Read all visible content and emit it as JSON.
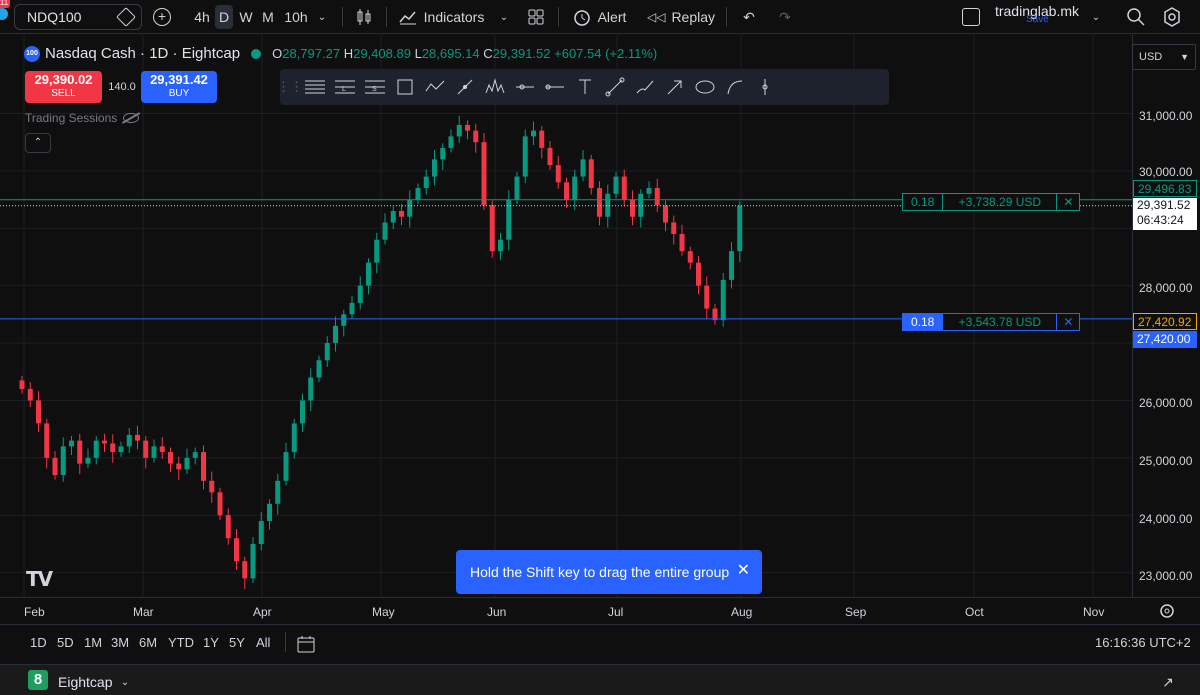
{
  "toolbar": {
    "symbol": "NDQ100",
    "notif_count": "11",
    "timeframes": [
      "4h",
      "D",
      "W",
      "M",
      "10h"
    ],
    "active_timeframe": "D",
    "indicators_label": "Indicators",
    "alert_label": "Alert",
    "replay_label": "Replay",
    "username": "tradinglab.mk",
    "save_label": "Save"
  },
  "legend": {
    "title": "Nasdaq Cash · 1D · Eightcap",
    "logo_text": "100",
    "o_key": "O",
    "o_val": "28,797.27",
    "h_key": "H",
    "h_val": "29,408.89",
    "l_key": "L",
    "l_val": "28,695.14",
    "c_key": "C",
    "c_val": "29,391.52",
    "change": "+607.54 (+2.11%)"
  },
  "trade": {
    "sell_price": "29,390.02",
    "sell_label": "SELL",
    "buy_price": "29,391.42",
    "buy_label": "BUY",
    "spread": "140.0"
  },
  "sessions_label": "Trading Sessions",
  "orders": [
    {
      "qty": "0.18",
      "pnl": "+3,738.29 USD",
      "price": 29496.83
    },
    {
      "qty": "0.18",
      "pnl": "+3,543.78 USD",
      "price": 27420.0
    }
  ],
  "price_axis": {
    "currency": "USD",
    "labels": [
      "31,000.00",
      "30,000.00",
      "28,000.00",
      "26,000.00",
      "25,000.00",
      "24,000.00",
      "23,000.00"
    ],
    "tag_upper": "29,496.83",
    "tag_current": "29,391.52",
    "tag_countdown": "06:43:24",
    "tag_order_price": "27,420.92",
    "tag_order_line": "27,420.00"
  },
  "time_axis": [
    "Feb",
    "Mar",
    "Apr",
    "May",
    "Jun",
    "Jul",
    "Aug",
    "Sep",
    "Oct",
    "Nov"
  ],
  "tooltip": "Hold the Shift key to drag the entire group",
  "ranges": [
    "1D",
    "5D",
    "1M",
    "3M",
    "6M",
    "YTD",
    "1Y",
    "5Y",
    "All"
  ],
  "clock": "16:16:36 UTC+2",
  "broker": {
    "logo": "8",
    "name": "Eightcap"
  },
  "colors": {
    "up": "#089981",
    "down": "#f23645",
    "accent": "#2962ff"
  },
  "chart_data": {
    "type": "candlestick",
    "title": "Nasdaq Cash · 1D · Eightcap",
    "ylim": [
      22750,
      31600
    ],
    "x_labels": [
      "Feb",
      "Mar",
      "Apr",
      "May",
      "Jun",
      "Jul",
      "Aug",
      "Sep",
      "Oct",
      "Nov"
    ],
    "close_series": [
      26200,
      26000,
      25600,
      25000,
      24700,
      25200,
      25300,
      24900,
      25000,
      25300,
      25250,
      25100,
      25200,
      25400,
      25300,
      25000,
      25200,
      25100,
      24900,
      24800,
      25000,
      25100,
      24600,
      24400,
      24000,
      23600,
      23200,
      22900,
      23500,
      23900,
      24200,
      24600,
      25100,
      25600,
      26000,
      26400,
      26700,
      27000,
      27300,
      27500,
      27700,
      28000,
      28400,
      28800,
      29100,
      29300,
      29200,
      29500,
      29700,
      29900,
      30200,
      30400,
      30600,
      30800,
      30700,
      30500,
      29400,
      28600,
      28800,
      29500,
      29900,
      30600,
      30700,
      30400,
      30100,
      29800,
      29500,
      29900,
      30200,
      29700,
      29200,
      29600,
      29900,
      29500,
      29200,
      29600,
      29700,
      29400,
      29100,
      28900,
      28600,
      28400,
      28000,
      27600,
      27400,
      28100,
      28600,
      29391.52
    ],
    "current_price": 29391.52
  }
}
